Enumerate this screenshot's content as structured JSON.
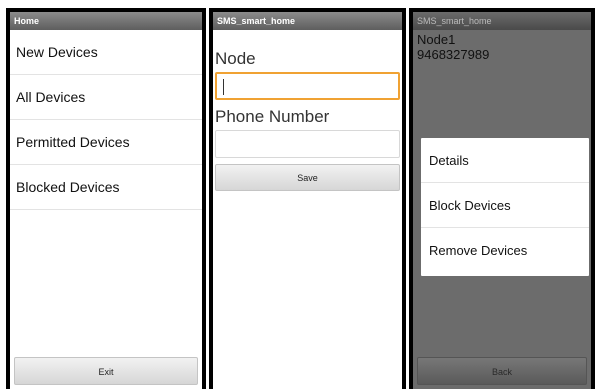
{
  "home": {
    "title": "Home",
    "menu": [
      {
        "label": "New Devices"
      },
      {
        "label": "All Devices"
      },
      {
        "label": "Permitted Devices"
      },
      {
        "label": "Blocked Devices"
      }
    ],
    "exit_label": "Exit"
  },
  "add_node": {
    "title": "SMS_smart_home",
    "node_label": "Node",
    "node_value": "",
    "phone_label": "Phone Number",
    "phone_value": "",
    "save_label": "Save"
  },
  "device_detail": {
    "title": "SMS_smart_home",
    "node_name": "Node1",
    "node_phone": "9468327989",
    "dialog": [
      {
        "label": "Details"
      },
      {
        "label": "Block Devices"
      },
      {
        "label": "Remove Devices"
      }
    ],
    "back_label": "Back"
  },
  "colors": {
    "focus_border": "#f0a233",
    "titlebar": "#6e6e6e",
    "dim_background": "#6c6c6c"
  }
}
